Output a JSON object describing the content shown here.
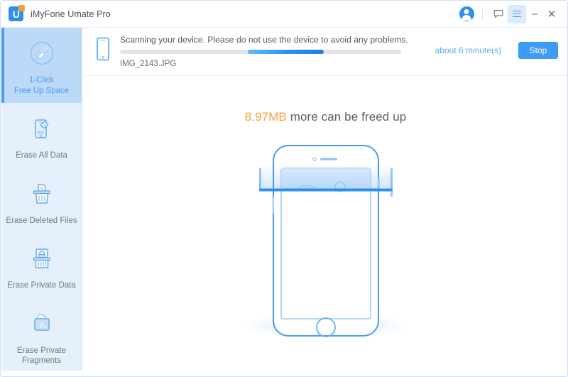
{
  "window": {
    "app_title": "iMyFone Umate Pro",
    "logo_letter": "U",
    "controls": {
      "account_icon": "user-avatar-icon",
      "feedback_icon": "feedback-message-icon",
      "menu_icon": "hamburger-menu-icon",
      "minimize_label": "–",
      "close_label": "✕"
    }
  },
  "sidebar": {
    "items": [
      {
        "id": "one-click-free-up-space",
        "label": "1-Click\nFree Up Space",
        "label_line1": "1-Click",
        "label_line2": "Free Up Space",
        "icon": "broom-circle-icon",
        "active": true
      },
      {
        "id": "erase-all-data",
        "label": "Erase All Data",
        "label_line1": "Erase All Data",
        "label_line2": "",
        "icon": "phone-eraser-icon",
        "active": false
      },
      {
        "id": "erase-deleted-files",
        "label": "Erase Deleted Files",
        "label_line1": "Erase Deleted Files",
        "label_line2": "",
        "icon": "trash-document-icon",
        "active": false
      },
      {
        "id": "erase-private-data",
        "label": "Erase Private Data",
        "label_line1": "Erase Private Data",
        "label_line2": "",
        "icon": "shredder-lock-icon",
        "active": false
      },
      {
        "id": "erase-private-fragments",
        "label": "Erase Private Fragments",
        "label_line1": "Erase Private",
        "label_line2": "Fragments",
        "icon": "folder-app-fragments-icon",
        "active": false
      }
    ]
  },
  "status": {
    "device_icon": "mobile-phone-icon",
    "scan_message": "Scanning your device. Please do not use the device to avoid any problems.",
    "current_file": "IMG_2143.JPG",
    "eta_text": "about 6 minute(s)",
    "stop_label": "Stop",
    "progress_percent": 46
  },
  "main": {
    "freed_size": "8.97MB",
    "headline_rest": " more can be freed up",
    "illustration": "iphone-scanning-illustration"
  },
  "colors": {
    "accent_blue": "#3d9cf5",
    "sidebar_bg": "#e6f0fc",
    "sidebar_active_bg": "#bcd9f8",
    "highlight_orange": "#f2a13c",
    "text_gray": "#545a63",
    "logo_blue": "#2f8fef",
    "logo_orange": "#f6a02a"
  }
}
